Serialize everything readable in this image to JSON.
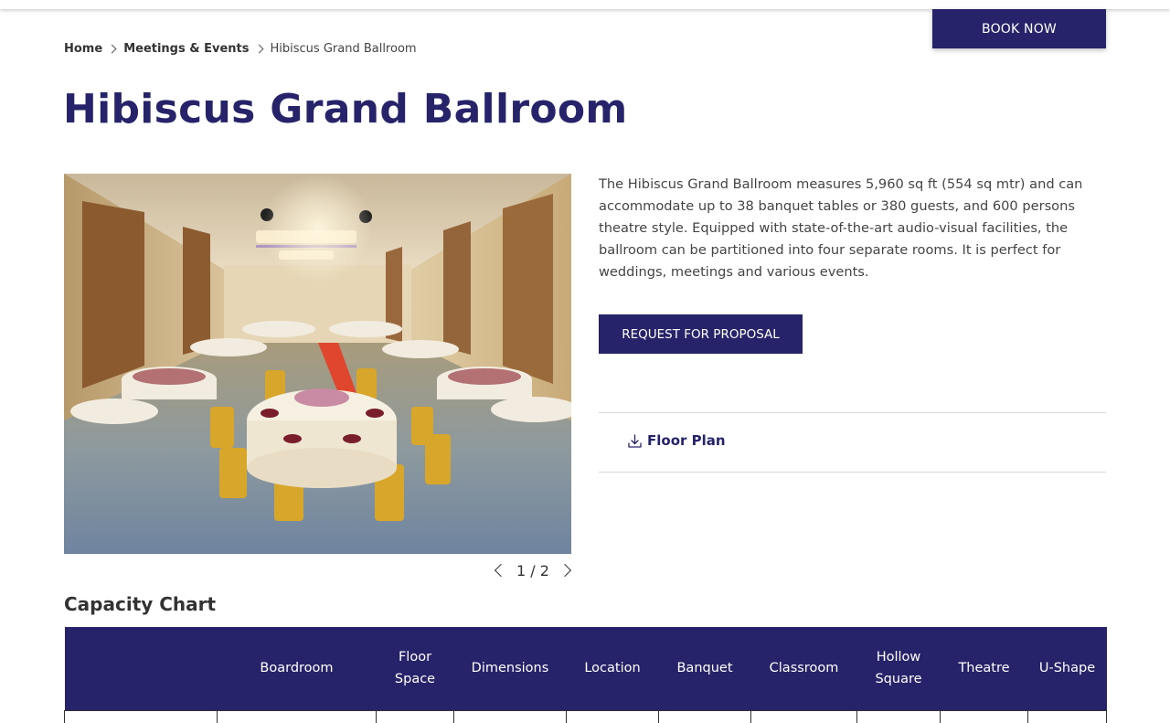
{
  "header": {
    "book_now": "BOOK NOW"
  },
  "breadcrumb": {
    "home": "Home",
    "meetings": "Meetings & Events",
    "current": "Hibiscus Grand Ballroom"
  },
  "page_title": "Hibiscus Grand Ballroom",
  "gallery": {
    "counter": "1 / 2"
  },
  "description": "The Hibiscus Grand Ballroom measures 5,960 sq ft (554 sq mtr) and can accommodate up to 38 banquet tables or 380 guests, and 600 persons theatre style. Equipped with state-of-the-art audio-visual facilities, the ballroom can be partitioned into four separate rooms. It is perfect for weddings, meetings and various events.",
  "rfp_button": "REQUEST FOR PROPOSAL",
  "floor_plan": "Floor Plan",
  "capacity_chart": {
    "heading": "Capacity Chart",
    "columns": [
      "",
      "Boardroom",
      "Floor Space",
      "Dimensions",
      "Location",
      "Banquet",
      "Classroom",
      "Hollow Square",
      "Theatre",
      "U-Shape"
    ]
  },
  "colors": {
    "brand": "#27236a",
    "text": "#333333"
  },
  "icons": [
    "chevron-right-icon",
    "chevron-left-icon",
    "download-icon"
  ]
}
